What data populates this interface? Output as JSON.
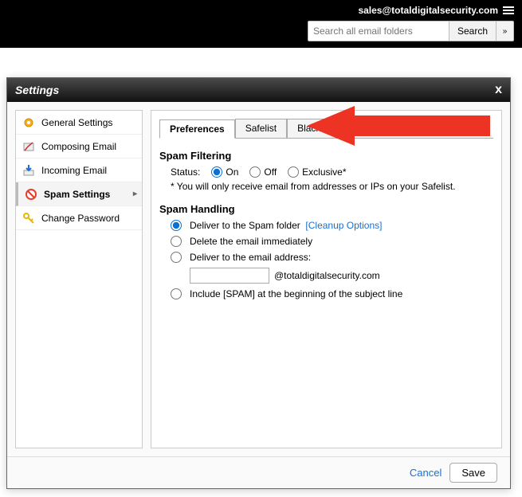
{
  "header": {
    "account_email": "sales@totaldigitalsecurity.com",
    "search_placeholder": "Search all email folders",
    "search_button": "Search"
  },
  "dialog": {
    "title": "Settings",
    "sidebar": {
      "items": [
        {
          "label": "General Settings",
          "icon": "gear"
        },
        {
          "label": "Composing Email",
          "icon": "compose"
        },
        {
          "label": "Incoming Email",
          "icon": "incoming"
        },
        {
          "label": "Spam Settings",
          "icon": "spam",
          "active": true
        },
        {
          "label": "Change Password",
          "icon": "key"
        }
      ]
    },
    "tabs": [
      {
        "label": "Preferences",
        "active": true
      },
      {
        "label": "Safelist"
      },
      {
        "label": "Blacklist"
      }
    ],
    "spam_filtering": {
      "heading": "Spam Filtering",
      "status_label": "Status:",
      "options": [
        "On",
        "Off",
        "Exclusive*"
      ],
      "selected": "On",
      "note": "* You will only receive email from addresses or IPs on your Safelist."
    },
    "spam_handling": {
      "heading": "Spam Handling",
      "cleanup_label": "[Cleanup Options]",
      "options": [
        "Deliver to the Spam folder",
        "Delete the email immediately",
        "Deliver to the email address:",
        "Include [SPAM] at the beginning of the subject line"
      ],
      "selected_index": 0,
      "email_domain": "@totaldigitalsecurity.com",
      "email_value": ""
    },
    "footer": {
      "cancel": "Cancel",
      "save": "Save"
    }
  }
}
